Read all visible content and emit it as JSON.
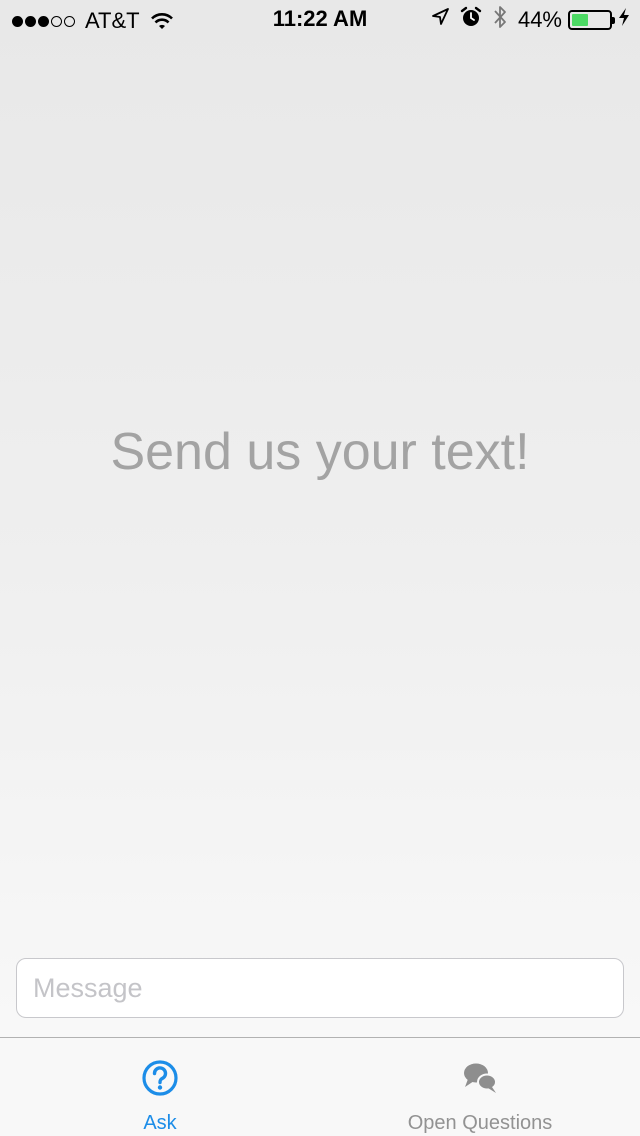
{
  "status_bar": {
    "carrier": "AT&T",
    "signal_strength": 3,
    "signal_max": 5,
    "time": "11:22 AM",
    "battery_percent": "44%",
    "battery_level": 0.44,
    "icons": [
      "wifi-icon",
      "location-arrow-icon",
      "alarm-icon",
      "bluetooth-icon",
      "battery-icon",
      "charging-bolt-icon"
    ]
  },
  "main": {
    "empty_state_text": "Send us your text!"
  },
  "composer": {
    "value": "",
    "placeholder": "Message"
  },
  "tab_bar": {
    "tabs": [
      {
        "label": "Ask",
        "icon": "question-circle-icon",
        "active": true
      },
      {
        "label": "Open Questions",
        "icon": "chat-bubbles-icon",
        "active": false
      }
    ]
  },
  "colors": {
    "accent": "#1c8de8",
    "inactive_tab": "#929292",
    "empty_state_text": "#a3a3a3",
    "battery_fill": "#4cd964"
  }
}
